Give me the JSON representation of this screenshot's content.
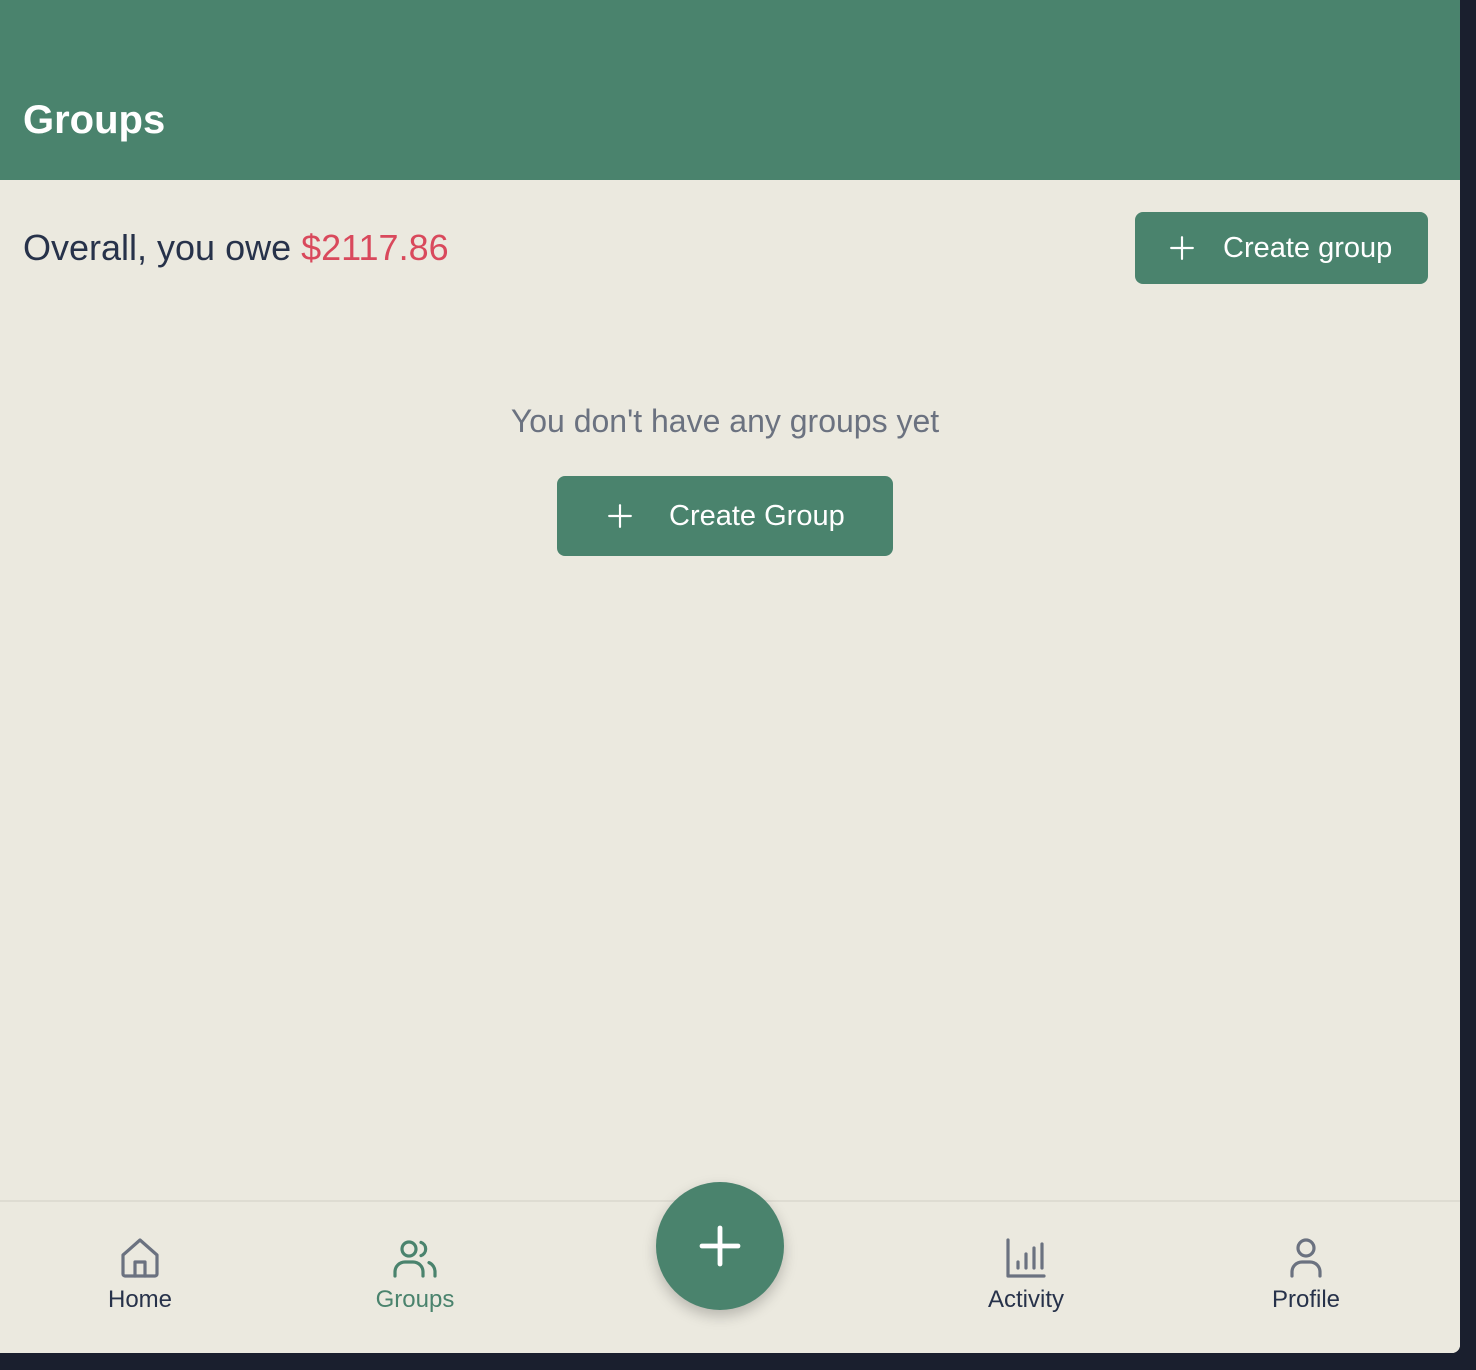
{
  "header": {
    "title": "Groups"
  },
  "summary": {
    "prefix": "Overall, you owe",
    "amount": "$2117.86"
  },
  "actions": {
    "create_group_top_label": "Create group",
    "create_group_center_label": "Create Group"
  },
  "empty_state": {
    "message": "You don't have any groups yet"
  },
  "nav": {
    "items": [
      {
        "label": "Home",
        "icon": "home-icon",
        "active": false
      },
      {
        "label": "Groups",
        "icon": "users-icon",
        "active": true
      },
      {
        "label": "Activity",
        "icon": "bar-chart-icon",
        "active": false
      },
      {
        "label": "Profile",
        "icon": "user-icon",
        "active": false
      }
    ],
    "fab_icon": "plus-icon"
  },
  "colors": {
    "brand": "#4a836d",
    "background": "#ebe9df",
    "debt": "#d9495c",
    "text": "#27324a",
    "muted": "#6b7280"
  }
}
